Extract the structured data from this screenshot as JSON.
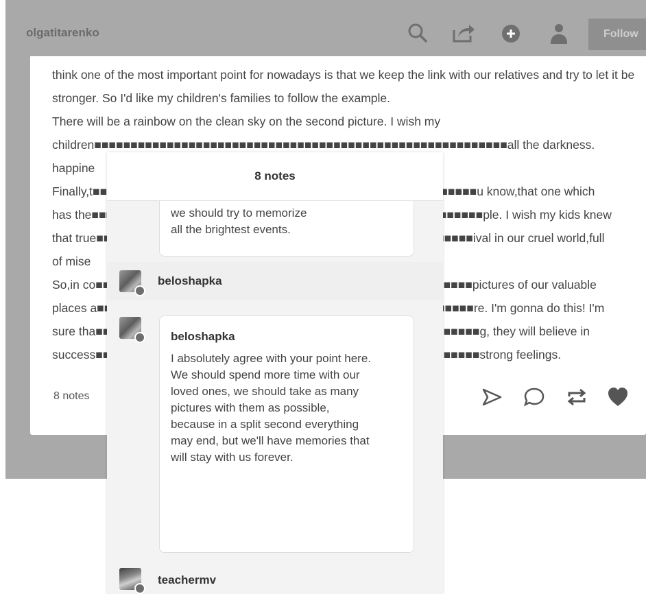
{
  "topbar": {
    "blog_name": "olgatitarenko",
    "follow_label": "Follow"
  },
  "post": {
    "paragraphs": [
      "think one of the most important point for nowadays is that we keep the link with our relatives and try to let it be stronger. So I'd like my children's families to follow the example.",
      "There will be a rainbow on the clean sky on the second picture. I wish my children■■■■■■■■■■■■■■■■■■■■■■■■■■■■■■■■■■■■■■■■■■■■■■■■■■■■■■■■■all the darkness.",
      "happine",
      "Finally,t■■■■■■■■■■■■■■■■■■■■■■■■■■■■■■■■■■■■■■■■■■■■■■■■■■■■■u know,that one which",
      "has the■■■■■■■■■■■■■■■■■■■■■■■■■■■■■■■■■■■■■■■■■■■■■■■■■■■■■■ple. I wish my kids knew",
      "that true■■■■■■■■■■■■■■■■■■■■■■■■■■■■■■■■■■■■■■■■■■■■■■■■■■■■ival in our cruel world,full",
      "of mise",
      "So,in co■■■■■■■■■■■■■■■■■■■■■■■■■■■■■■■■■■■■■■■■■■■■■■■■■■■■pictures of our valuable",
      "places a■■■■■■■■■■■■■■■■■■■■■■■■■■■■■■■■■■■■■■■■■■■■■■■■■■■■re. I'm gonna do this! I'm",
      "sure tha■■■■■■■■■■■■■■■■■■■■■■■■■■■■■■■■■■■■■■■■■■■■■■■■■■■■■g, they will believe in",
      "success■■■■■■■■■■■■■■■■■■■■■■■■■■■■■■■■■■■■■■■■■■■■■■■■■■■■■strong feelings."
    ],
    "notes_count": "8 notes"
  },
  "notes_popover": {
    "title": "8 notes",
    "partial_reply_lines": [
      "we should try to memorize",
      "all the brightest events."
    ],
    "like_user": "beloshapka",
    "reply_user": "beloshapka",
    "reply_text": "I absolutely agree with your point here. We should spend more time with our loved ones, we should take as many pictures with them as possible, because in a split second everything may end, but we'll have memories that will stay with us forever.",
    "next_user": "teachermv"
  },
  "colors": {
    "backdrop": "#a9a9a9",
    "follow_button": "#8f8f8f",
    "icon_gray": "#6f6f6f"
  },
  "icons": [
    "search-icon",
    "share-icon",
    "add-circle-icon",
    "user-icon",
    "send-icon",
    "reply-icon",
    "reblog-icon",
    "heart-icon"
  ]
}
